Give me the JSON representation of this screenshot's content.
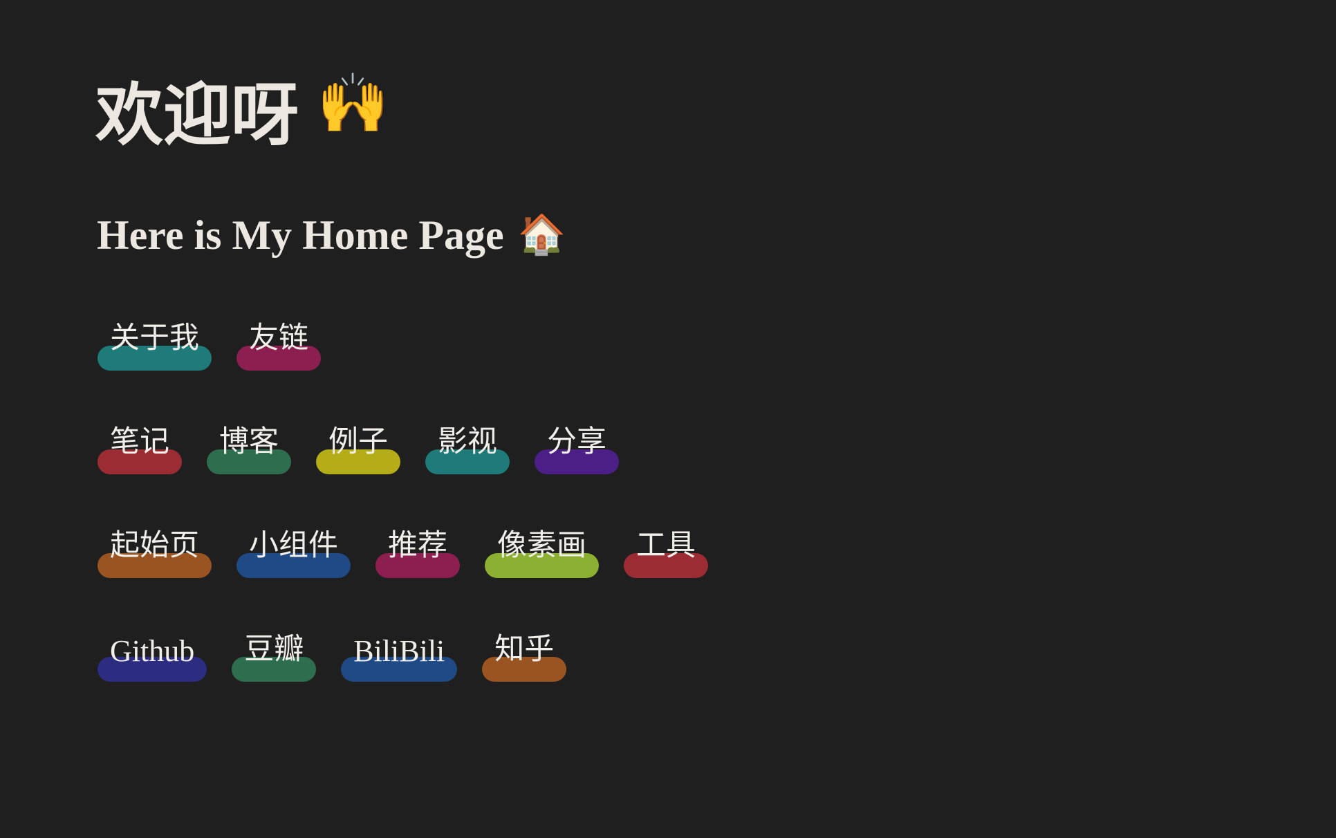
{
  "header": {
    "title": "欢迎呀",
    "title_emoji": "🙌",
    "subtitle": "Here is My Home Page",
    "subtitle_emoji": "🏠"
  },
  "rows": [
    [
      {
        "label": "关于我",
        "color": "#1f7a7a"
      },
      {
        "label": "友链",
        "color": "#8c1f4f"
      }
    ],
    [
      {
        "label": "笔记",
        "color": "#9c2c33"
      },
      {
        "label": "博客",
        "color": "#2e6e4e"
      },
      {
        "label": "例子",
        "color": "#b5ad17"
      },
      {
        "label": "影视",
        "color": "#1f7a7a"
      },
      {
        "label": "分享",
        "color": "#4b1f85"
      }
    ],
    [
      {
        "label": "起始页",
        "color": "#9a5422"
      },
      {
        "label": "小组件",
        "color": "#1f4a85"
      },
      {
        "label": "推荐",
        "color": "#8c1f4f"
      },
      {
        "label": "像素画",
        "color": "#8cb032"
      },
      {
        "label": "工具",
        "color": "#9c2c33"
      }
    ],
    [
      {
        "label": "Github",
        "color": "#2c2c80"
      },
      {
        "label": "豆瓣",
        "color": "#2e6e4e"
      },
      {
        "label": "BiliBili",
        "color": "#1f4a85"
      },
      {
        "label": "知乎",
        "color": "#9a5422"
      }
    ]
  ]
}
